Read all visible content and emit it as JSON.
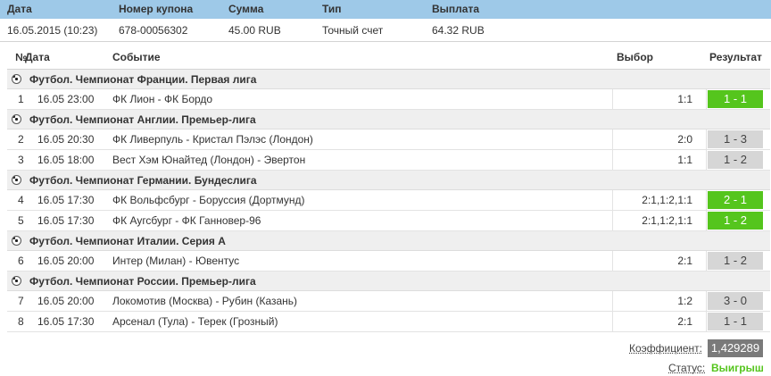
{
  "coupon": {
    "headers": {
      "date": "Дата",
      "number": "Номер купона",
      "sum": "Сумма",
      "type": "Тип",
      "payout": "Выплата"
    },
    "values": {
      "date": "16.05.2015 (10:23)",
      "number": "678-00056302",
      "sum": "45.00 RUB",
      "type": "Точный счет",
      "payout": "64.32 RUB"
    }
  },
  "table": {
    "headers": {
      "no": "№",
      "date": "Дата",
      "event": "Событие",
      "choice": "Выбор",
      "result": "Результат"
    },
    "groups": [
      {
        "title": "Футбол. Чемпионат Франции. Первая лига",
        "rows": [
          {
            "no": "1",
            "date": "16.05 23:00",
            "event": "ФК Лион - ФК Бордо",
            "choice": "1:1",
            "result": "1 - 1",
            "win": true
          }
        ]
      },
      {
        "title": "Футбол. Чемпионат Англии. Премьер-лига",
        "rows": [
          {
            "no": "2",
            "date": "16.05 20:30",
            "event": "ФК Ливерпуль - Кристал Пэлэс (Лондон)",
            "choice": "2:0",
            "result": "1 - 3",
            "win": false
          },
          {
            "no": "3",
            "date": "16.05 18:00",
            "event": "Вест Хэм Юнайтед (Лондон) - Эвертон",
            "choice": "1:1",
            "result": "1 - 2",
            "win": false
          }
        ]
      },
      {
        "title": "Футбол. Чемпионат Германии. Бундеслига",
        "rows": [
          {
            "no": "4",
            "date": "16.05 17:30",
            "event": "ФК Вольфсбург - Боруссия (Дортмунд)",
            "choice": "2:1,1:2,1:1",
            "result": "2 - 1",
            "win": true
          },
          {
            "no": "5",
            "date": "16.05 17:30",
            "event": "ФК Аугсбург - ФК Ганновер-96",
            "choice": "2:1,1:2,1:1",
            "result": "1 - 2",
            "win": true
          }
        ]
      },
      {
        "title": "Футбол. Чемпионат Италии. Серия А",
        "rows": [
          {
            "no": "6",
            "date": "16.05 20:00",
            "event": "Интер (Милан) - Ювентус",
            "choice": "2:1",
            "result": "1 - 2",
            "win": false
          }
        ]
      },
      {
        "title": "Футбол. Чемпионат России. Премьер-лига",
        "rows": [
          {
            "no": "7",
            "date": "16.05 20:00",
            "event": "Локомотив (Москва) - Рубин (Казань)",
            "choice": "1:2",
            "result": "3 - 0",
            "win": false
          },
          {
            "no": "8",
            "date": "16.05 17:30",
            "event": "Арсенал (Тула) - Терек (Грозный)",
            "choice": "2:1",
            "result": "1 - 1",
            "win": false
          }
        ]
      }
    ]
  },
  "summary": {
    "coef_label": "Коэффициент:",
    "coef_value": "1,429289",
    "status_label": "Статус:",
    "status_value": "Выигрыш"
  },
  "colors": {
    "header_bg": "#9ec9e8",
    "win": "#55c51d",
    "lose": "#d6d6d6",
    "coef_bg": "#7a7a7a"
  },
  "icons": {
    "group": "soccer-ball-icon"
  }
}
